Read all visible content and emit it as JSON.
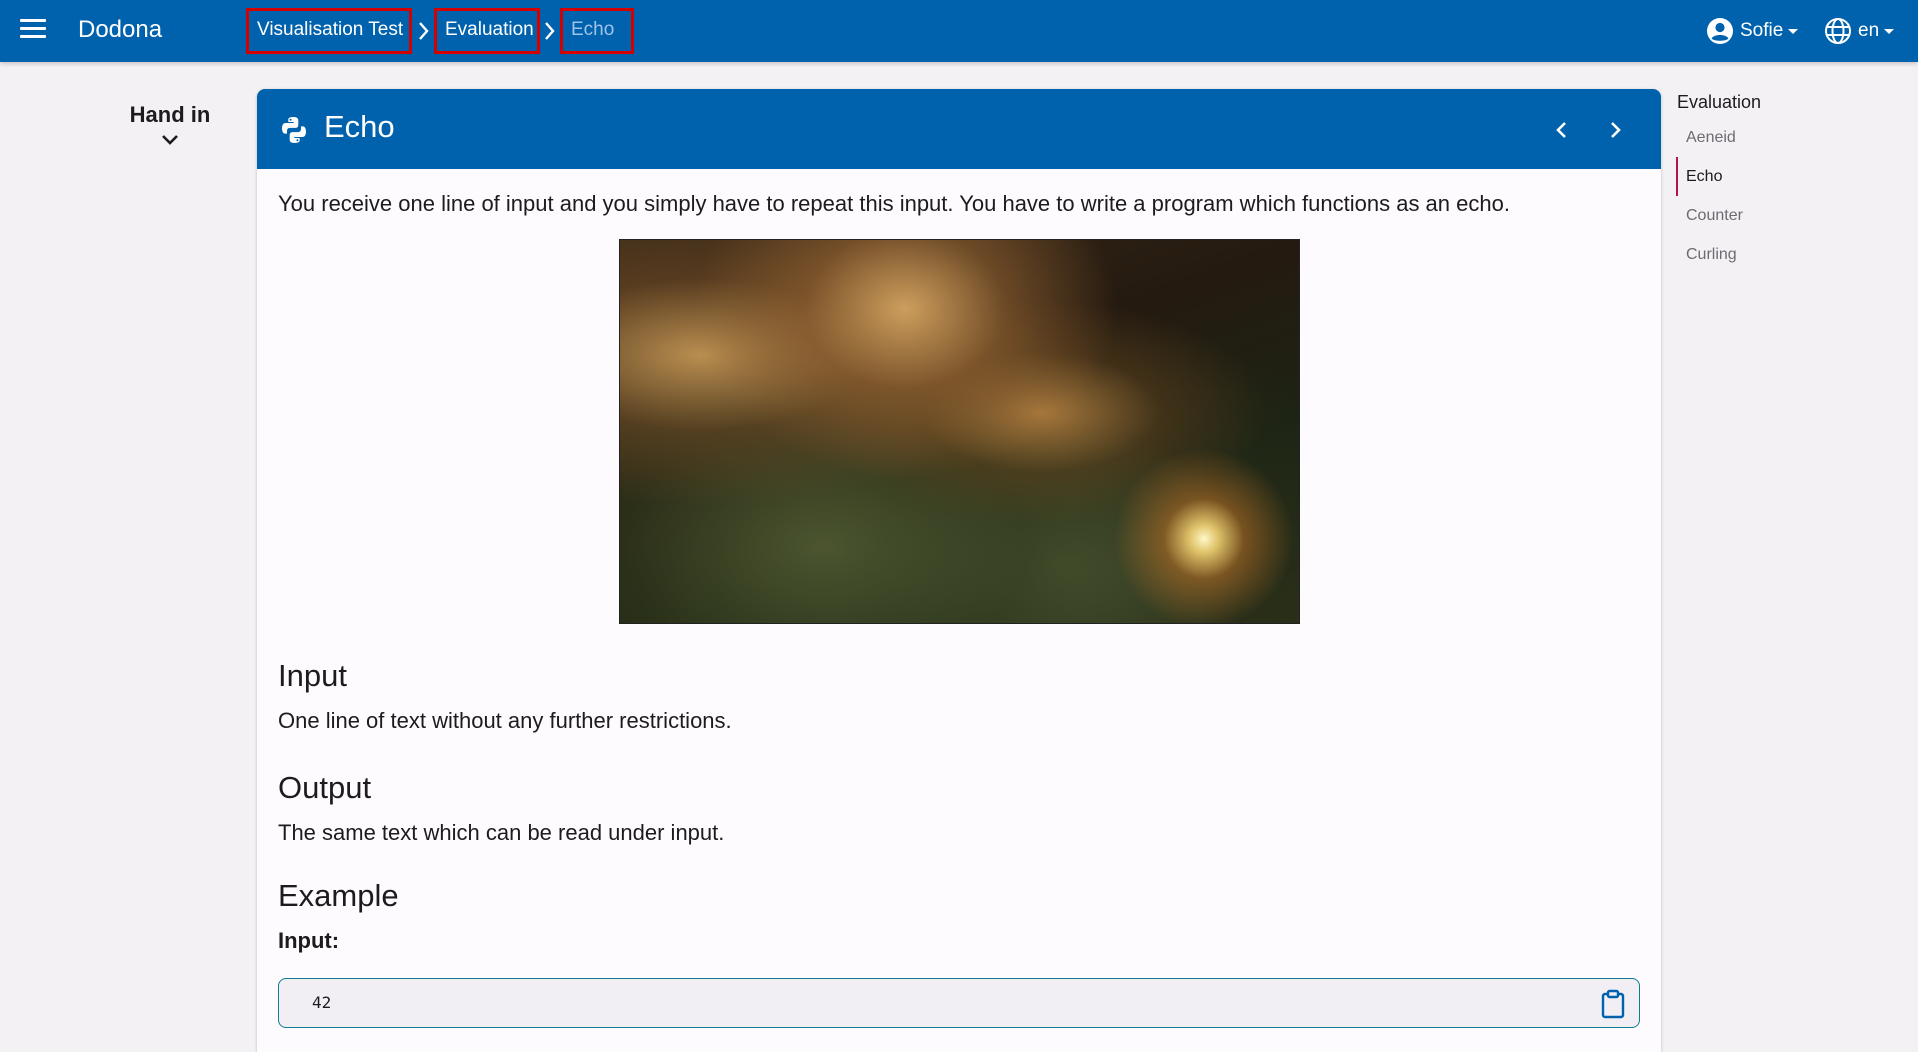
{
  "app": {
    "brand": "Dodona"
  },
  "breadcrumbs": [
    {
      "label": "Visualisation Test"
    },
    {
      "label": "Evaluation"
    },
    {
      "label": "Echo"
    }
  ],
  "user": {
    "name": "Sofie",
    "icon": "account-circle-icon"
  },
  "language": {
    "code": "en",
    "icon": "globe-icon"
  },
  "hand_in": {
    "label": "Hand in"
  },
  "exercise": {
    "title": "Echo",
    "icon": "python-icon",
    "description": "You receive one line of input and you simply have to repeat this input. You have to write a program which functions as an echo.",
    "sections": {
      "input_heading": "Input",
      "input_text": "One line of text without any further restrictions.",
      "output_heading": "Output",
      "output_text": "The same text which can be read under input.",
      "example_heading": "Example",
      "example_input_label": "Input:",
      "example_input_value": "42"
    }
  },
  "toc": {
    "title": "Evaluation",
    "items": [
      {
        "label": "Aeneid"
      },
      {
        "label": "Echo",
        "active": true
      },
      {
        "label": "Counter"
      },
      {
        "label": "Curling"
      }
    ]
  },
  "colors": {
    "primary": "#0062ad",
    "highlight_border": "#d40000",
    "toc_active": "#b3154b"
  }
}
